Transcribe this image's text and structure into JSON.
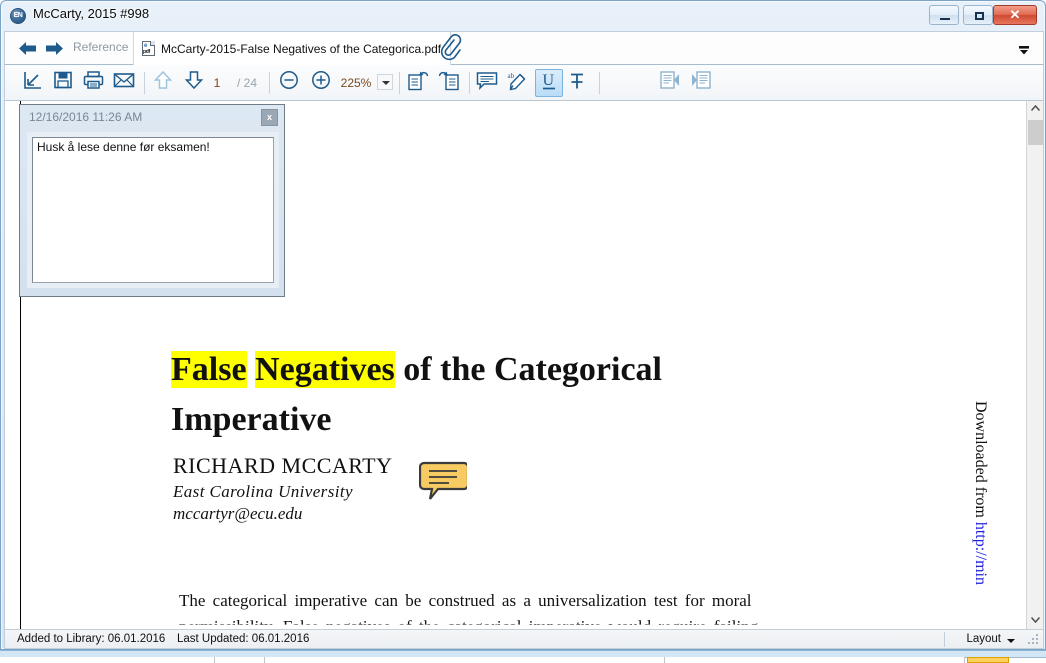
{
  "window": {
    "title": "McCarty, 2015 #998",
    "app_icon": "endnote-logo-icon",
    "minimize_label": "Minimize",
    "maximize_label": "Maximize",
    "close_label": "Close"
  },
  "tabbar": {
    "back_label": "Back",
    "forward_label": "Forward",
    "reference_label": "Reference",
    "document_tab_label": "McCarty-2015-False Negatives of the Categorica.pdf",
    "pdf_icon_e": "e",
    "pdf_icon_pdf": "pdf",
    "attachment_label": "Attachments",
    "overflow_label": "More tabs"
  },
  "toolbar": {
    "open_pdf_label": "Open PDF",
    "save_label": "Save",
    "print_label": "Print",
    "email_label": "E-mail",
    "prev_page_label": "Previous page",
    "next_page_label": "Next page",
    "page_current": "1",
    "page_total": "/ 24",
    "zoom_out_label": "Zoom Out",
    "zoom_in_label": "Zoom In",
    "zoom_value": "225%",
    "zoom_dropdown_label": "Zoom presets",
    "rotate_left_label": "Rotate Left",
    "rotate_right_label": "Rotate Right",
    "sticky_note_label": "Insert Sticky Note",
    "highlight_label": "Highlight Text",
    "underline_label": "Underline Text",
    "strikeout_label": "Strikeout Text",
    "underline_active": true,
    "find_next_label": "Find Next",
    "find_prev_label": "Find Previous"
  },
  "note": {
    "date": "12/16/2016 11:26 AM",
    "close_label": "x",
    "text": "Husk å lese denne før eksamen!"
  },
  "pdf": {
    "title_highlight_1": "False",
    "title_highlight_2": "Negatives",
    "title_rest": " of the Categorical",
    "title_line2": "Imperative",
    "author": "RICHARD MCCARTY",
    "affiliation": "East Carolina University",
    "email": "mccartyr@ecu.edu",
    "note_marker_label": "Sticky note annotation",
    "body_line_1": "The categorical imperative can be construed as a universalization test for moral",
    "body_line_2": "permissibility.  False negatives of the categorical imperative would require failing",
    "side_text_prefix": "Downloaded from ",
    "side_text_link": "http://min",
    "highlight_color": "#ffff00",
    "note_marker_color": "#f5c council"
  },
  "scrollbar": {
    "up_label": "Scroll up",
    "down_label": "Scroll down",
    "thumb_label": "Scroll thumb"
  },
  "statusbar": {
    "added_to_library": "Added to Library: 06.01.2016",
    "last_updated": "Last Updated: 06.01.2016",
    "layout_label": "Layout"
  },
  "colors": {
    "accent": "#1f5d8f",
    "toolbar_icon": "#1e5b8c",
    "highlight_yellow": "#ffff00",
    "note_yellow": "#f7cb62",
    "close_red": "#cf4a31",
    "page_number": "#8b3a16"
  }
}
